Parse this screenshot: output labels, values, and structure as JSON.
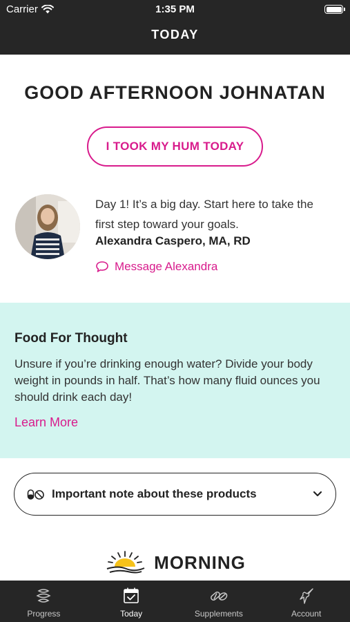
{
  "status_bar": {
    "carrier": "Carrier",
    "time": "1:35 PM"
  },
  "header": {
    "title": "TODAY"
  },
  "greeting": "GOOD AFTERNOON JOHNATAN",
  "hum_button_label": "I TOOK MY HUM TODAY",
  "coach": {
    "message": "Day 1! It’s a big day. Start here to take the first step toward your goals.",
    "name": "Alexandra Caspero, MA, RD",
    "message_link": "Message Alexandra"
  },
  "food_for_thought": {
    "title": "Food For Thought",
    "body": "Unsure if you’re drinking enough water? Divide your body weight in pounds in half. That’s how many fluid ounces you should drink each day!",
    "link": "Learn More"
  },
  "important_note": {
    "label": "Important note about these products"
  },
  "section": {
    "morning_label": "MORNING"
  },
  "tab_bar": {
    "items": [
      {
        "label": "Progress",
        "icon": "progress-icon"
      },
      {
        "label": "Today",
        "icon": "calendar-check-icon"
      },
      {
        "label": "Supplements",
        "icon": "pills-icon"
      },
      {
        "label": "Account",
        "icon": "hummingbird-icon"
      }
    ],
    "active": "Today"
  },
  "colors": {
    "accent": "#d81b8c",
    "header_bg": "#262626",
    "card_bg": "#d3f5f0"
  }
}
